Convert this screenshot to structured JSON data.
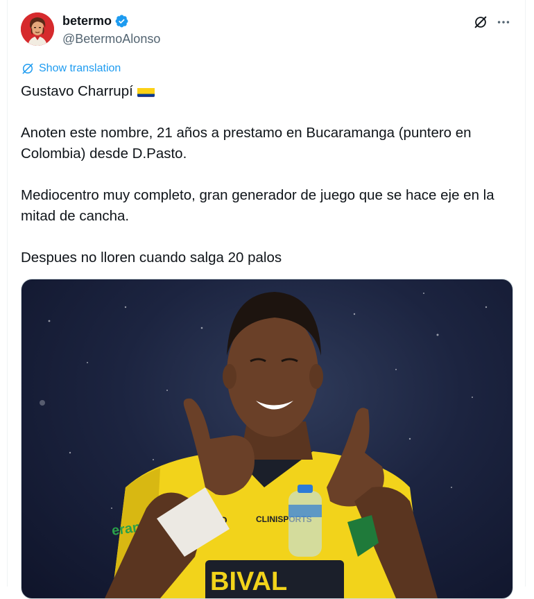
{
  "author": {
    "display_name": "betermo",
    "handle": "@BetermoAlonso",
    "verified": true,
    "avatar_icon": "cartoon-avatar-icon"
  },
  "actions": {
    "grok_icon": "grok-slash-icon",
    "more_icon": "more-dots-icon"
  },
  "translate": {
    "label": "Show translation",
    "icon": "globe-translate-icon"
  },
  "tweet": {
    "line1": "Gustavo Charrupí",
    "flag_icon": "colombia-flag-icon",
    "para2": "Anoten este nombre, 21 años a prestamo en Bucaramanga (puntero en Colombia) desde D.Pasto.",
    "para3": "Mediocentro muy completo, gran generador de juego que se hace eje en la mitad de cancha.",
    "para4": "Despues no lloren cuando salga 20 palos"
  },
  "media": {
    "jersey_text_1": "CLINISPORTS",
    "jersey_text_2": "erano",
    "jersey_text_3": "OTTO",
    "jersey_text_4": "BIVAL"
  },
  "colors": {
    "accent": "#1d9bf0",
    "text": "#0f1419",
    "secondary": "#536471",
    "jersey_yellow": "#f2d31b"
  }
}
